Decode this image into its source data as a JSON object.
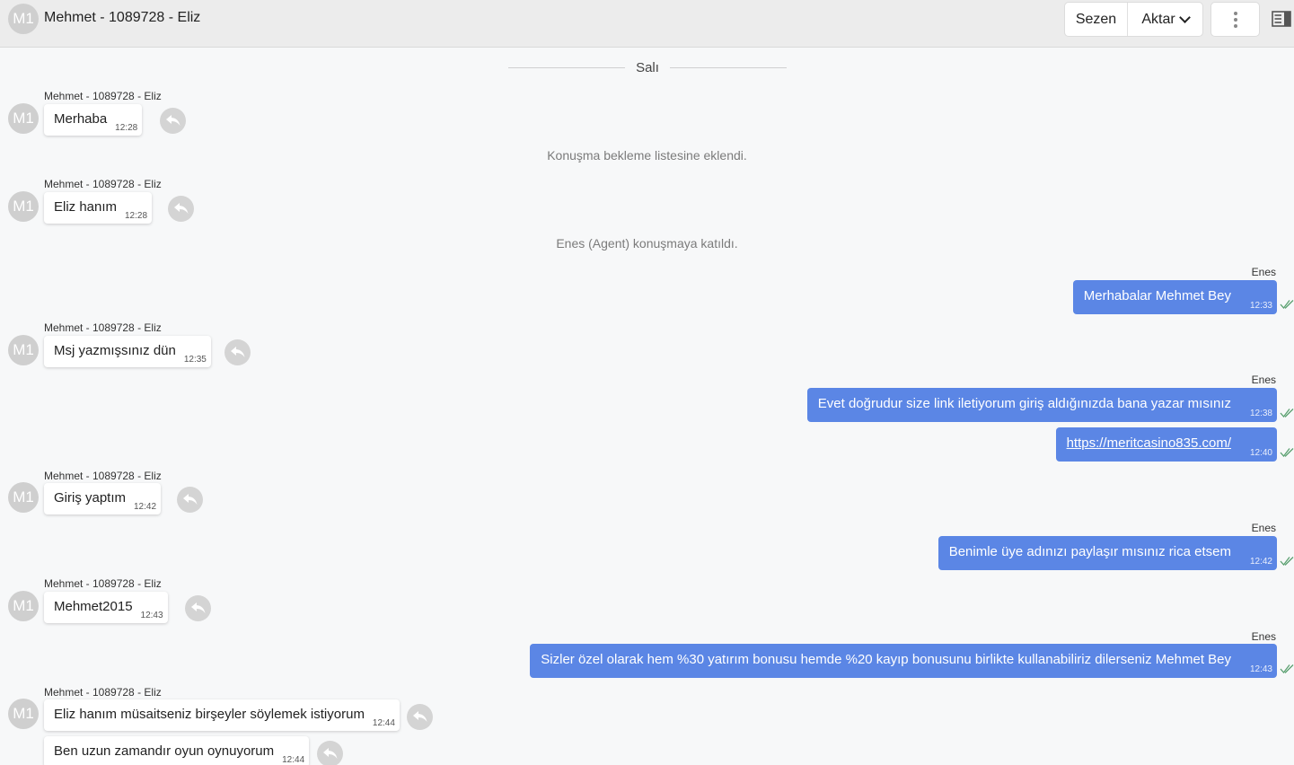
{
  "header": {
    "avatar_initials": "M1",
    "title": "Mehmet - 1089728 - Eliz",
    "sezen_label": "Sezen",
    "aktar_label": "Aktar"
  },
  "day_separator": "Salı",
  "system_messages": [
    "Konuşma bekleme listesine eklendi.",
    "Enes (Agent) konuşmaya katıldı."
  ],
  "messages": [
    {
      "dir": "in",
      "sender": "Mehmet - 1089728 - Eliz",
      "avatar": "M1",
      "text": "Merhaba",
      "time": "12:28"
    },
    {
      "dir": "in",
      "sender": "Mehmet - 1089728 - Eliz",
      "avatar": "M1",
      "text": "Eliz hanım",
      "time": "12:28"
    },
    {
      "dir": "out",
      "sender": "Enes",
      "text": "Merhabalar Mehmet Bey",
      "time": "12:33"
    },
    {
      "dir": "in",
      "sender": "Mehmet - 1089728 - Eliz",
      "avatar": "M1",
      "text": "Msj yazmışsınız dün",
      "time": "12:35"
    },
    {
      "dir": "out",
      "sender": "Enes",
      "text": "Evet doğrudur size link iletiyorum giriş aldığınızda bana yazar mısınız",
      "time": "12:38"
    },
    {
      "dir": "out",
      "text": "https://meritcasino835.com/",
      "time": "12:40"
    },
    {
      "dir": "in",
      "sender": "Mehmet - 1089728 - Eliz",
      "avatar": "M1",
      "text": "Giriş yaptım",
      "time": "12:42"
    },
    {
      "dir": "out",
      "sender": "Enes",
      "text": "Benimle üye adınızı paylaşır mısınız rica etsem",
      "time": "12:42"
    },
    {
      "dir": "in",
      "sender": "Mehmet - 1089728 - Eliz",
      "avatar": "M1",
      "text": "Mehmet2015",
      "time": "12:43"
    },
    {
      "dir": "out",
      "sender": "Enes",
      "text": "Sizler özel olarak hem %30 yatırım bonusu hemde %20 kayıp bonusunu birlikte kullanabiliriz dilerseniz Mehmet Bey",
      "time": "12:43"
    },
    {
      "dir": "in",
      "sender": "Mehmet - 1089728 - Eliz",
      "avatar": "M1",
      "text": "Eliz hanım müsaitseniz birşeyler söylemek istiyorum",
      "time": "12:44"
    },
    {
      "dir": "in",
      "text": "Ben uzun zamandır oyun oynuyorum",
      "time": "12:44"
    }
  ],
  "colors": {
    "outgoing_bubble": "#5b86e5",
    "avatar_bg": "#cfcfcf",
    "reply_btn": "#d4d4d4",
    "read_check": "#5aa070"
  },
  "icons": {
    "reply": "reply-arrow-icon",
    "read": "double-check-icon",
    "more": "more-vertical-icon",
    "panel": "panel-toggle-icon",
    "dropdown": "chevron-down-icon"
  }
}
